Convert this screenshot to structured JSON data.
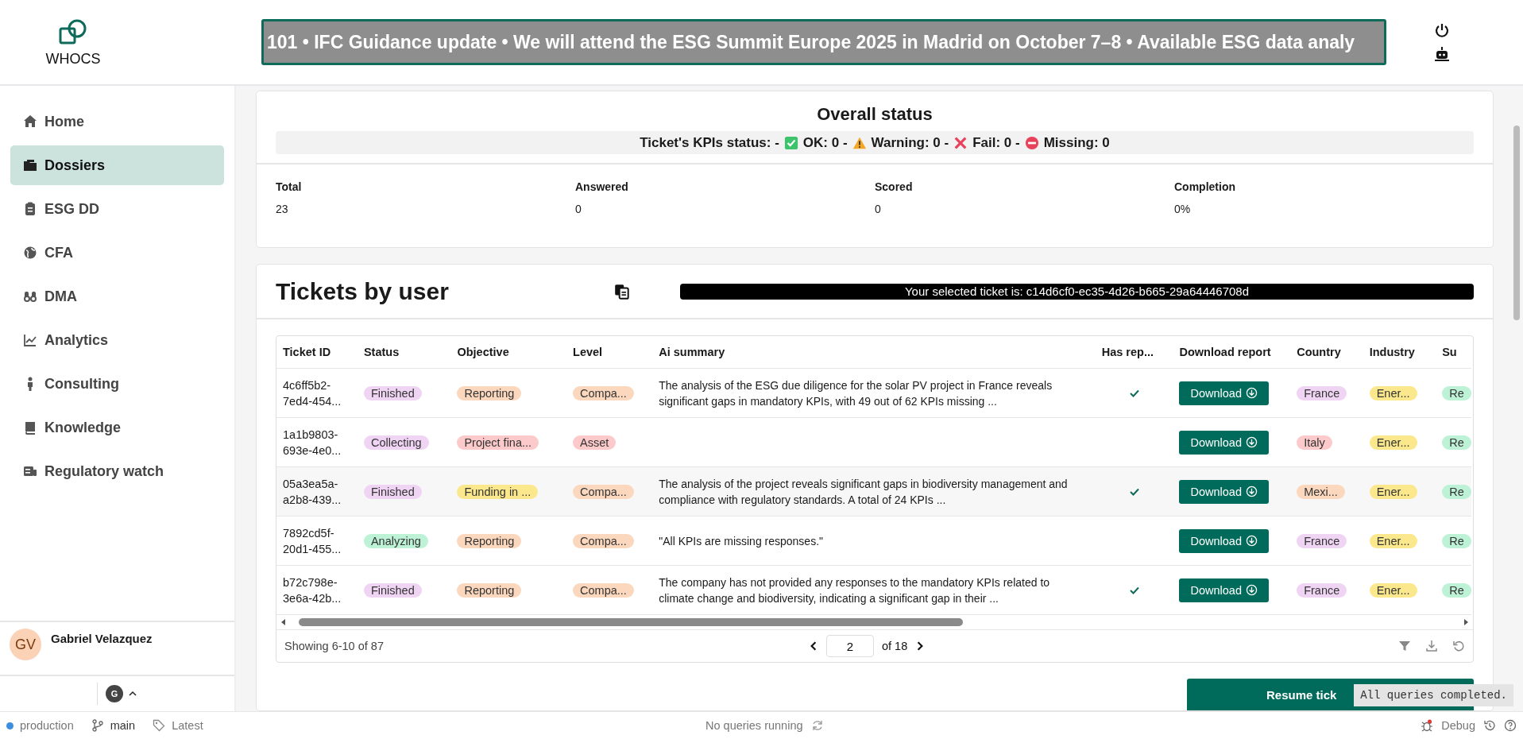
{
  "header": {
    "logo_text": "WHOCS",
    "ticker": "101 • IFC Guidance update • We will attend the ESG Summit Europe 2025 in Madrid on October 7–8 • Available ESG data analy"
  },
  "sidebar": {
    "items": [
      {
        "label": "Home",
        "selected": false
      },
      {
        "label": "Dossiers",
        "selected": true
      },
      {
        "label": "ESG DD",
        "selected": false
      },
      {
        "label": "CFA",
        "selected": false
      },
      {
        "label": "DMA",
        "selected": false
      },
      {
        "label": "Analytics",
        "selected": false
      },
      {
        "label": "Consulting",
        "selected": false
      },
      {
        "label": "Knowledge",
        "selected": false
      },
      {
        "label": "Regulatory watch",
        "selected": false
      }
    ],
    "user": {
      "initials": "GV",
      "name": "Gabriel Velazquez"
    },
    "account_badge": "G"
  },
  "overall_status": {
    "title": "Overall status",
    "kpi_label": "Ticket's KPIs status: -",
    "kpis": [
      {
        "kind": "ok",
        "text": "OK: 0 -"
      },
      {
        "kind": "warning",
        "text": "Warning: 0 -"
      },
      {
        "kind": "fail",
        "text": "Fail: 0 -"
      },
      {
        "kind": "missing",
        "text": "Missing: 0"
      }
    ],
    "stats": [
      {
        "label": "Total",
        "value": "23"
      },
      {
        "label": "Answered",
        "value": "0"
      },
      {
        "label": "Scored",
        "value": "0"
      },
      {
        "label": "Completion",
        "value": "0%"
      }
    ]
  },
  "tickets": {
    "title": "Tickets by user",
    "selected_banner": "Your selected ticket is: c14d6cf0-ec35-4d26-b665-29a64446708d",
    "table": {
      "columns": [
        "Ticket ID",
        "Status",
        "Objective",
        "Level",
        "Ai summary",
        "Has rep...",
        "Download report",
        "Country",
        "Industry",
        "Su"
      ],
      "rows": [
        {
          "ticket_id": "4c6ff5b2-7ed4-454...",
          "status": {
            "text": "Finished",
            "color": "#f0d4f4"
          },
          "objective": {
            "text": "Reporting",
            "color": "#fbd7bd"
          },
          "level": {
            "text": "Compa...",
            "color": "#fbd7bd"
          },
          "summary": "The analysis of the ESG due diligence for the solar PV project in France reveals significant gaps in mandatory KPIs, with 49 out of 62 KPIs missing ...",
          "has_report": true,
          "download": "Download",
          "country": {
            "text": "France",
            "color": "#f0d4f4"
          },
          "industry": {
            "text": "Ener...",
            "color": "#fbe88c"
          },
          "column_10": {
            "text": "Re",
            "color": "#bdf2d6"
          }
        },
        {
          "ticket_id": "1a1b9803-693e-4e0...",
          "status": {
            "text": "Collecting",
            "color": "#f0d4f4"
          },
          "objective": {
            "text": "Project fina...",
            "color": "#fccaca"
          },
          "level": {
            "text": "Asset",
            "color": "#fccaca"
          },
          "has_report": false,
          "download": "Download",
          "country": {
            "text": "Italy",
            "color": "#fccaca"
          },
          "industry": {
            "text": "Ener...",
            "color": "#fbe88c"
          },
          "column_10": {
            "text": "Re",
            "color": "#bdf2d6"
          }
        },
        {
          "ticket_id": "05a3ea5a-a2b8-439...",
          "status": {
            "text": "Finished",
            "color": "#f0d4f4"
          },
          "objective": {
            "text": "Funding in ...",
            "color": "#fbe88c"
          },
          "level": {
            "text": "Compa...",
            "color": "#fbd7bd"
          },
          "summary": "The analysis of the project reveals significant gaps in biodiversity management and compliance with regulatory standards. A total of 24 KPIs ...",
          "has_report": true,
          "download": "Download",
          "country": {
            "text": "Mexi...",
            "color": "#fbd7bd"
          },
          "industry": {
            "text": "Ener...",
            "color": "#fbe88c"
          },
          "column_10": {
            "text": "Re",
            "color": "#bdf2d6"
          }
        },
        {
          "ticket_id": "7892cd5f-20d1-455...",
          "status": {
            "text": "Analyzing",
            "color": "#bdf2d6"
          },
          "objective": {
            "text": "Reporting",
            "color": "#fbd7bd"
          },
          "level": {
            "text": "Compa...",
            "color": "#fbd7bd"
          },
          "summary": "\"All KPIs are missing responses.\"",
          "has_report": false,
          "download": "Download",
          "country": {
            "text": "France",
            "color": "#f0d4f4"
          },
          "industry": {
            "text": "Ener...",
            "color": "#fbe88c"
          },
          "column_10": {
            "text": "Re",
            "color": "#bdf2d6"
          }
        },
        {
          "ticket_id": "b72c798e-3e6a-42b...",
          "status": {
            "text": "Finished",
            "color": "#f0d4f4"
          },
          "objective": {
            "text": "Reporting",
            "color": "#fbd7bd"
          },
          "level": {
            "text": "Compa...",
            "color": "#fbd7bd"
          },
          "summary": "The company has not provided any responses to the mandatory KPIs related to climate change and biodiversity, indicating a significant gap in their ...",
          "has_report": true,
          "download": "Download",
          "country": {
            "text": "France",
            "color": "#f0d4f4"
          },
          "industry": {
            "text": "Ener...",
            "color": "#fbe88c"
          },
          "column_10": {
            "text": "Re",
            "color": "#bdf2d6"
          }
        }
      ]
    },
    "footer": {
      "showing": "Showing 6-10 of 87",
      "page": "2",
      "of_pages": "of 18"
    },
    "resume_button": "Resume tick"
  },
  "toast": "All queries completed.",
  "status_bar": {
    "environment": "production",
    "branch": "main",
    "tag": "Latest",
    "queries": "No queries running",
    "debug": "Debug"
  }
}
